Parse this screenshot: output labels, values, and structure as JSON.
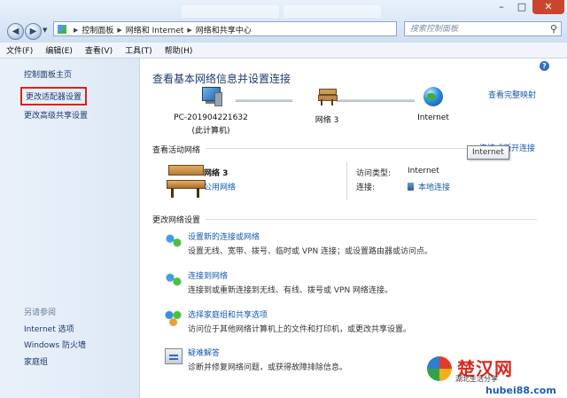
{
  "window": {
    "breadcrumb": [
      "控制面板",
      "网络和 Internet",
      "网络和共享中心"
    ],
    "search_placeholder": "搜索控制面板",
    "controls": {
      "minimize": "–",
      "maximize": "□",
      "close": "✕"
    }
  },
  "menu": [
    "文件(F)",
    "编辑(E)",
    "查看(V)",
    "工具(T)",
    "帮助(H)"
  ],
  "sidebar": {
    "home": "控制面板主页",
    "adapter_settings": "更改适配器设置",
    "advanced_sharing": "更改高级共享设置",
    "see_also_label": "另请参阅",
    "see_also": [
      "Internet 选项",
      "Windows 防火墙",
      "家庭组"
    ]
  },
  "main": {
    "title": "查看基本网络信息并设置连接",
    "view_full_map": "查看完整映射",
    "map": {
      "pc_name": "PC-201904221632",
      "pc_sub": "(此计算机)",
      "network": "网络  3",
      "internet": "Internet"
    },
    "active_heading": "查看活动网络",
    "connect_disconnect": "连接或断开连接",
    "tooltip": "Internet",
    "active_network": {
      "name": "网络  3",
      "type": "公用网络",
      "access_type_label": "访问类型:",
      "access_type_value": "Internet",
      "connections_label": "连接:",
      "connections_value": "本地连接"
    },
    "settings_heading": "更改网络设置",
    "tasks": [
      {
        "title": "设置新的连接或网络",
        "desc": "设置无线、宽带、拨号、临时或 VPN 连接；或设置路由器或访问点。",
        "icon": "network-setup-icon"
      },
      {
        "title": "连接到网络",
        "desc": "连接到或重新连接到无线、有线、拨号或 VPN 网络连接。",
        "icon": "connect-network-icon"
      },
      {
        "title": "选择家庭组和共享选项",
        "desc": "访问位于其他网络计算机上的文件和打印机，或更改共享设置。",
        "icon": "homegroup-icon"
      },
      {
        "title": "疑难解答",
        "desc": "诊断并修复网络问题，或获得故障排除信息。",
        "icon": "troubleshoot-icon"
      }
    ]
  },
  "watermark": {
    "name": "楚汉网",
    "sub": "湖北生活分享",
    "url": "hubei88.com"
  },
  "colors": {
    "link": "#1a5aa8",
    "highlight_border": "#e0201d",
    "sidebar_bg": "#dde8f5"
  }
}
